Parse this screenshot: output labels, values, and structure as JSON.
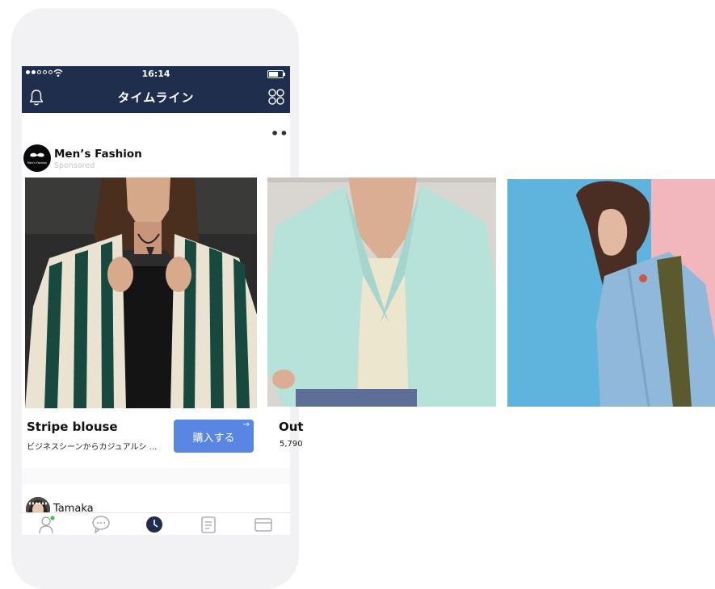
{
  "status_bar": {
    "time": "16:14"
  },
  "app_bar": {
    "title": "タイムライン"
  },
  "post": {
    "more_label": "•••",
    "brand_name": "Men’s Fashion",
    "brand_logo_text": "Men's Fashion",
    "sponsored_label": "Sponsored",
    "items": [
      {
        "name": "Stripe blouse",
        "description": "ビジネスシーンからカジュアルシ ...",
        "cta_label": "購入する"
      },
      {
        "name": "Out",
        "price": "5,790"
      }
    ]
  },
  "next_post": {
    "user_name": "Tamaka"
  },
  "tab_bar": {
    "tabs": [
      "friends-icon",
      "chat-icon",
      "timeline-icon",
      "news-icon",
      "wallet-icon"
    ],
    "active": "timeline-icon"
  },
  "colors": {
    "header": "#1e2e4c",
    "cta": "#5a86e3",
    "online_dot": "#3fc14a"
  }
}
